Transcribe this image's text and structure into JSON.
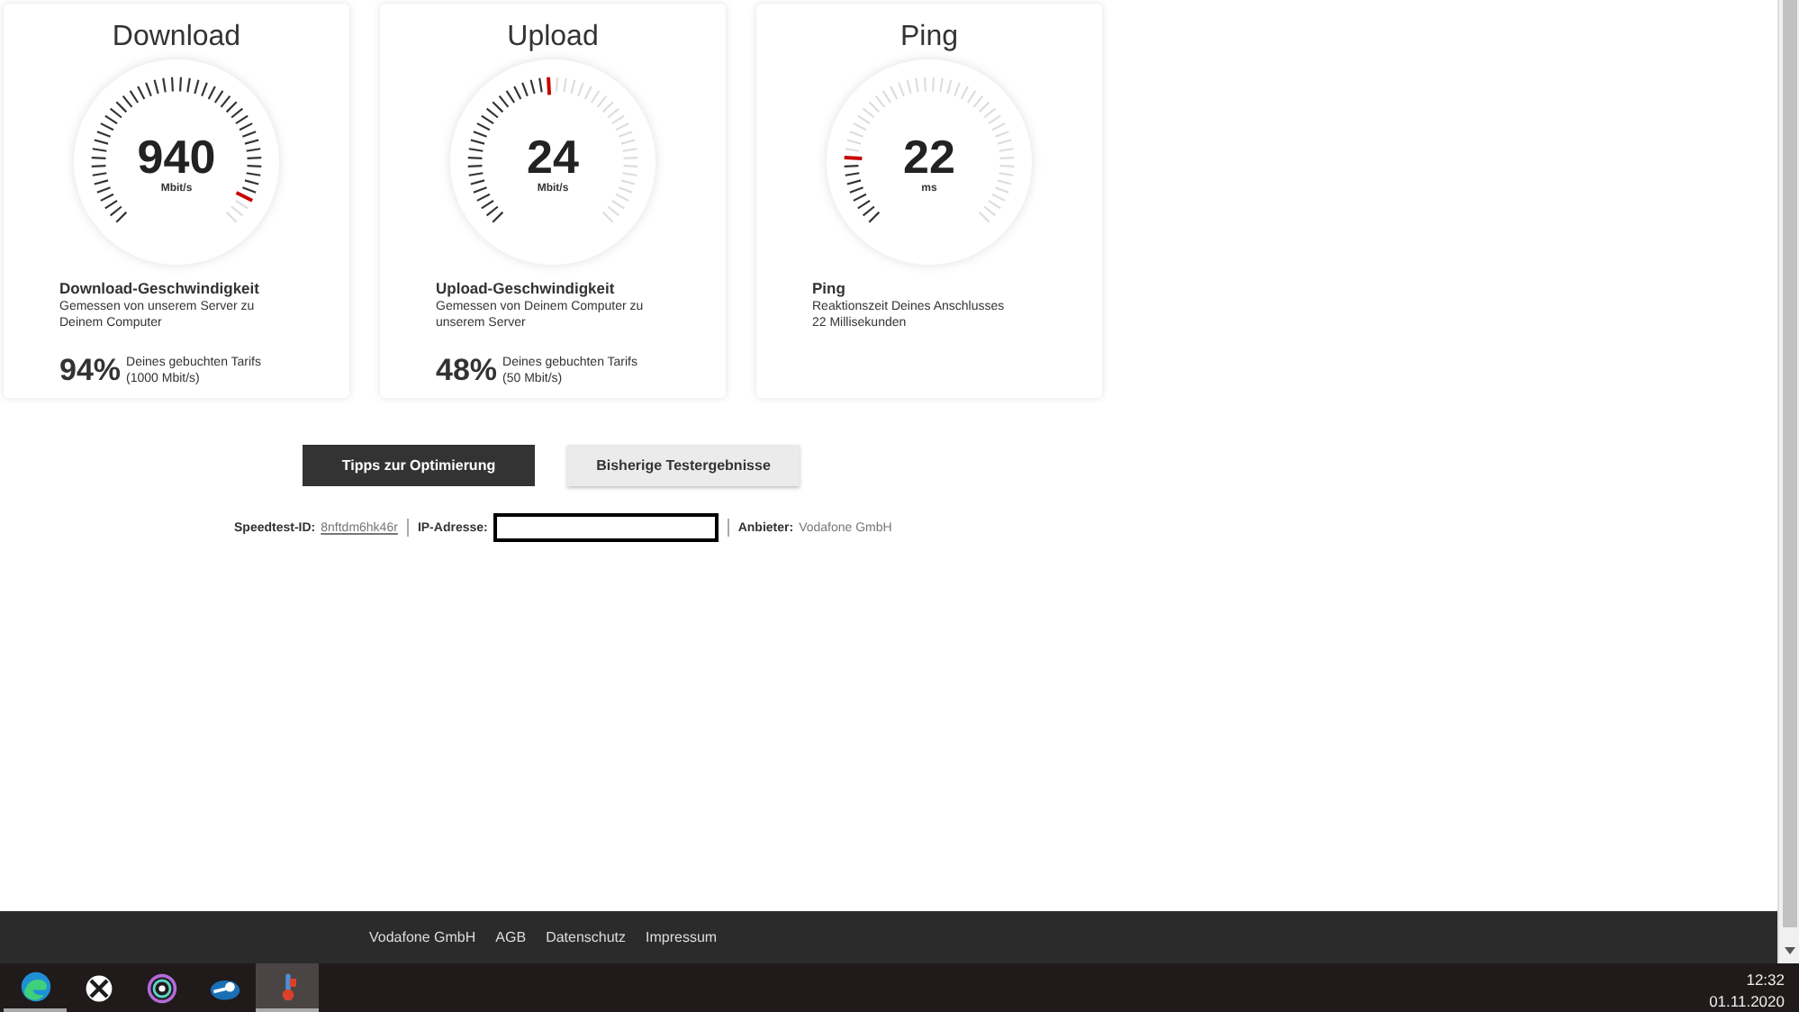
{
  "cards": [
    {
      "title": "Download",
      "value": "940",
      "unit": "Mbit/s",
      "heading": "Download-Geschwindigkeit",
      "description": [
        "Gemessen von unserem Server zu",
        "Deinem Computer"
      ],
      "percent": "94%",
      "tariff": [
        "Deines gebuchten Tarifs",
        "(1000 Mbit/s)"
      ]
    },
    {
      "title": "Upload",
      "value": "24",
      "unit": "Mbit/s",
      "heading": "Upload-Geschwindigkeit",
      "description": [
        "Gemessen von Deinem Computer zu",
        "unserem Server"
      ],
      "percent": "48%",
      "tariff": [
        "Deines gebuchten Tarifs",
        "(50 Mbit/s)"
      ]
    },
    {
      "title": "Ping",
      "value": "22",
      "unit": "ms",
      "heading": "Ping",
      "description": [
        "Reaktionszeit Deines Anschlusses",
        "22 Millisekunden"
      ]
    }
  ],
  "buttons": [
    {
      "label": "Tipps zur Optimierung",
      "kind": "primary"
    },
    {
      "label": "Bisherige Testergebnisse",
      "kind": "secondary"
    }
  ],
  "info": {
    "speedtest_id_label": "Speedtest-ID:",
    "speedtest_id": "8nftdm6hk46r",
    "ip_label": "IP-Adresse:",
    "provider_label": "Anbieter:",
    "provider": "Vodafone GmbH"
  },
  "footer_links": [
    "Vodafone GmbH",
    "AGB",
    "Datenschutz",
    "Impressum"
  ],
  "taskbar": {
    "apps": [
      {
        "kind": "swirl",
        "selected": false,
        "running": true
      },
      {
        "kind": "xcircle",
        "selected": false,
        "running": false
      },
      {
        "kind": "rings",
        "selected": false,
        "running": false
      },
      {
        "kind": "knob",
        "selected": false,
        "running": false
      },
      {
        "kind": "thermo",
        "selected": true,
        "running": true
      }
    ],
    "time": "12:32",
    "date": "01.11.2020"
  }
}
